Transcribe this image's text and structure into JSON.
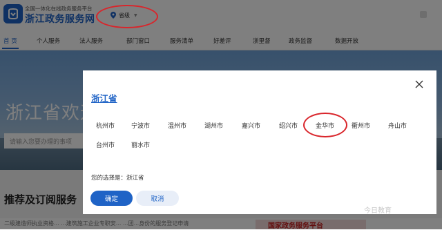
{
  "header": {
    "subtitle": "全国一体化在线政务服务平台",
    "site_name": "浙江政务服务网",
    "region_label": "省级"
  },
  "nav": {
    "items": [
      "首 页",
      "个人服务",
      "法人服务",
      "部门窗口",
      "服务清单",
      "好差评",
      "浙里督",
      "政务监督",
      "数据开放"
    ],
    "active_index": 0
  },
  "background_page": {
    "hero_title": "浙江省欢迎",
    "search_placeholder": "请输入您要办理的事项",
    "section_title": "推荐及订阅服务",
    "strip_text": "二级建造师执业资格...     ...建筑施工企业专职安...     ...团...身份的服务登记申请",
    "banner_text": "国家政务服务平台"
  },
  "modal": {
    "province": "浙江省",
    "cities_row1": [
      "杭州市",
      "宁波市",
      "温州市",
      "湖州市",
      "嘉兴市",
      "绍兴市",
      "金华市",
      "衢州市",
      "舟山市"
    ],
    "cities_row2": [
      "台州市",
      "丽水市"
    ],
    "selection_text": "您的选择是：浙江省",
    "confirm_label": "确定",
    "cancel_label": "取消"
  },
  "watermark": "今日教育",
  "colors": {
    "brand_blue": "#1f63c6",
    "annotation_red": "#d9252b"
  },
  "icons": [
    "logo-icon",
    "location-pin-icon",
    "caret-down-icon",
    "close-icon"
  ]
}
